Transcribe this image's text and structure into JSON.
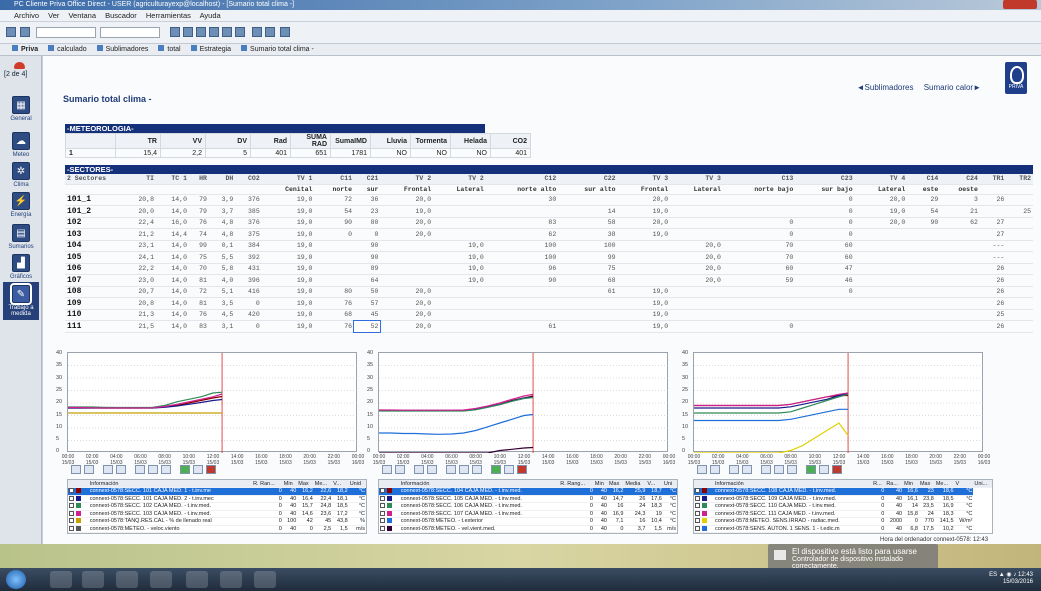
{
  "window": {
    "title": "PC Cliente Priva Office Direct - USER (agriculturayexp@localhost) - [Sumario total clima -]"
  },
  "menu": [
    "Archivo",
    "Ver",
    "Ventana",
    "Buscador",
    "Herramientas",
    "Ayuda"
  ],
  "tabs": [
    "Priva",
    "calculado",
    "Sublimadores",
    "total",
    "Estrategia",
    "Sumario total clima -"
  ],
  "sidebar": {
    "page_indicator": "[2 de 4]",
    "items": [
      {
        "label": "General",
        "icon": "general-icon"
      },
      {
        "label": "Meteo",
        "icon": "meteo-icon"
      },
      {
        "label": "Clima",
        "icon": "clima-icon"
      },
      {
        "label": "Energía",
        "icon": "energia-icon"
      },
      {
        "label": "Sumarios",
        "icon": "sumarios-icon"
      },
      {
        "label": "Gráficos",
        "icon": "graficos-icon"
      },
      {
        "label": "Trabajo a medida",
        "icon": "trabajo-icon"
      }
    ]
  },
  "page": {
    "title": "Sumario total clima -",
    "links": [
      "◄Sublimadores",
      "Sumario calor►"
    ],
    "logo": "PRIVA"
  },
  "meteo": {
    "heading": "-METEOROLOGIA-",
    "columns": [
      "TR",
      "VV",
      "DV",
      "Rad",
      "SUMA RAD",
      "SumaIMD",
      "Lluvia",
      "Tormenta",
      "Helada",
      "CO2"
    ],
    "row_label": "1",
    "values": [
      "15,4",
      "2,2",
      "5",
      "401",
      "651",
      "1781",
      "NO",
      "NO",
      "NO",
      "401"
    ]
  },
  "sectores": {
    "heading": "-SECTORES-",
    "columns": [
      "2 Sectores",
      "TI",
      "TC 1",
      "HR",
      "DH",
      "CO2",
      "TV 1",
      "C11",
      "C21",
      "TV 2",
      "TV 2",
      "C12",
      "C22",
      "TV 3",
      "TV 3",
      "C13",
      "C23",
      "TV 4",
      "C14",
      "C24",
      "TR1",
      "TR2"
    ],
    "subcolumns": [
      "",
      "",
      "",
      "",
      "",
      "",
      "Cenital",
      "norte",
      "sur",
      "Frontal",
      "Lateral",
      "norte alto",
      "sur alto",
      "Frontal",
      "Lateral",
      "norte bajo",
      "sur bajo",
      "Lateral",
      "este",
      "oeste",
      "",
      ""
    ],
    "rows": [
      [
        "101_1",
        "20,8",
        "14,0",
        "79",
        "3,9",
        "376",
        "19,0",
        "72",
        "36",
        "20,0",
        "",
        "30",
        "",
        "20,0",
        "",
        "",
        "0",
        "20,0",
        "29",
        "3",
        "26",
        ""
      ],
      [
        "101_2",
        "20,0",
        "14,0",
        "79",
        "3,7",
        "385",
        "19,0",
        "54",
        "23",
        "19,0",
        "",
        "",
        "14",
        "19,0",
        "",
        "",
        "0",
        "19,0",
        "54",
        "21",
        "",
        "25"
      ],
      [
        "102",
        "22,4",
        "16,0",
        "76",
        "4,8",
        "376",
        "19,0",
        "90",
        "80",
        "20,0",
        "",
        "83",
        "58",
        "20,0",
        "",
        "0",
        "0",
        "20,0",
        "90",
        "62",
        "27",
        ""
      ],
      [
        "103",
        "21,2",
        "14,4",
        "74",
        "4,8",
        "375",
        "19,0",
        "0",
        "0",
        "20,0",
        "",
        "62",
        "38",
        "19,0",
        "",
        "0",
        "0",
        "",
        "",
        "",
        "27",
        ""
      ],
      [
        "104",
        "23,1",
        "14,0",
        "99",
        "0,1",
        "384",
        "19,0",
        "",
        "90",
        "",
        "19,0",
        "100",
        "100",
        "",
        "20,0",
        "70",
        "60",
        "",
        "",
        "",
        "---",
        ""
      ],
      [
        "105",
        "24,1",
        "14,0",
        "75",
        "5,5",
        "392",
        "19,0",
        "",
        "90",
        "",
        "19,0",
        "100",
        "99",
        "",
        "20,0",
        "70",
        "60",
        "",
        "",
        "",
        "---",
        ""
      ],
      [
        "106",
        "22,2",
        "14,0",
        "70",
        "5,8",
        "431",
        "19,0",
        "",
        "89",
        "",
        "19,0",
        "96",
        "75",
        "",
        "20,0",
        "60",
        "47",
        "",
        "",
        "",
        "26",
        ""
      ],
      [
        "107",
        "23,0",
        "14,0",
        "81",
        "4,0",
        "396",
        "19,0",
        "",
        "64",
        "",
        "19,0",
        "90",
        "68",
        "",
        "20,0",
        "59",
        "46",
        "",
        "",
        "",
        "26",
        ""
      ],
      [
        "108",
        "20,7",
        "14,0",
        "72",
        "5,1",
        "416",
        "19,0",
        "80",
        "50",
        "20,0",
        "",
        "",
        "61",
        "19,0",
        "",
        "",
        "0",
        "",
        "",
        "",
        "26",
        ""
      ],
      [
        "109",
        "20,8",
        "14,0",
        "81",
        "3,5",
        "0",
        "19,0",
        "76",
        "57",
        "20,0",
        "",
        "",
        "",
        "19,0",
        "",
        "",
        "",
        "",
        "",
        "",
        "26",
        ""
      ],
      [
        "110",
        "21,3",
        "14,0",
        "76",
        "4,5",
        "420",
        "19,0",
        "68",
        "45",
        "20,0",
        "",
        "",
        "",
        "19,0",
        "",
        "",
        "",
        "",
        "",
        "",
        "25",
        ""
      ],
      [
        "111",
        "21,5",
        "14,0",
        "83",
        "3,1",
        "0",
        "19,0",
        "76",
        "52",
        "20,0",
        "",
        "61",
        "",
        "19,0",
        "",
        "0",
        "",
        "",
        "",
        "",
        "26",
        ""
      ]
    ]
  },
  "chart_common": {
    "y_ticks": [
      "40",
      "35",
      "30",
      "25",
      "20",
      "15",
      "10",
      "5",
      "0"
    ],
    "x_ticks": [
      "00:00 15/03",
      "02:00 15/03",
      "04:00 15/03",
      "06:00 15/03",
      "08:00 15/03",
      "10:00 15/03",
      "12:00 15/03",
      "14:00 15/03",
      "16:00 15/03",
      "18:00 15/03",
      "20:00 15/03",
      "22:00 15/03",
      "00:00 16/03"
    ]
  },
  "chart_data": [
    {
      "type": "line",
      "ylim": [
        0,
        40
      ],
      "x": [
        "00:00",
        "01:00",
        "02:00",
        "03:00",
        "04:00",
        "05:00",
        "06:00",
        "07:00",
        "08:00",
        "09:00",
        "10:00",
        "11:00",
        "12:00",
        "12:45"
      ],
      "series": [
        {
          "name": "connext-0578:SECC. 101 CAJA MED. 1 - t.inv.med.",
          "color": "#8b0000",
          "values": [
            18,
            18,
            18,
            18,
            18,
            18,
            18,
            18,
            18.5,
            19,
            20,
            21,
            22,
            22.6
          ]
        },
        {
          "name": "connext-0578:SECC. 101 CAJA MED. 2 - t.inv.med.",
          "color": "#1a1a8c",
          "values": [
            18,
            18,
            18,
            18,
            18,
            18,
            18,
            18,
            18.3,
            18.8,
            19.5,
            20.2,
            21,
            21.4
          ]
        },
        {
          "name": "connext-0578:SECC. 102 CAJA MED. - t.inv.med.",
          "color": "#2e8b57",
          "values": [
            18.4,
            18.4,
            18.4,
            18.3,
            18.2,
            18.2,
            18.2,
            18.3,
            19,
            20.5,
            21.5,
            22.5,
            24,
            24.3
          ]
        },
        {
          "name": "connext-0578:SECC. 103 CAJA MED. - t.inv.med.",
          "color": "#d02090",
          "values": [
            18.2,
            18.2,
            18.1,
            18,
            18,
            18,
            18,
            18.1,
            18.6,
            19.5,
            20.5,
            21.5,
            22.5,
            23.6
          ]
        },
        {
          "name": "connext-0578:TANQ.RES.CAL - % de llenado real",
          "color": "#c8a000",
          "values": [
            16,
            16,
            16,
            16,
            16,
            16,
            16,
            16,
            16,
            16,
            16,
            16,
            16,
            16
          ]
        },
        {
          "name": "connext-0578:METEO. - veloc.viento",
          "color": "#555555",
          "values": [
            null,
            null,
            null,
            null,
            null,
            null,
            null,
            null,
            null,
            null,
            null,
            null,
            null,
            null
          ]
        }
      ]
    },
    {
      "type": "line",
      "ylim": [
        0,
        40
      ],
      "x": [
        "00:00",
        "01:00",
        "02:00",
        "03:00",
        "04:00",
        "05:00",
        "06:00",
        "07:00",
        "08:00",
        "09:00",
        "10:00",
        "11:00",
        "12:00",
        "12:45"
      ],
      "series": [
        {
          "name": "connext-0578:SECC. 104 CAJA MED. - t.inv.med.",
          "color": "#8b0000",
          "values": [
            17,
            17,
            17,
            17,
            17,
            17,
            17,
            17,
            17.5,
            18.5,
            19.5,
            21,
            22,
            22.8
          ]
        },
        {
          "name": "connext-0578:SECC. 105 CAJA MED. - t.inv.med.",
          "color": "#1a1a8c",
          "values": [
            17,
            17,
            17,
            17,
            17,
            17,
            17,
            17,
            17.4,
            18.4,
            19.4,
            20.8,
            22,
            22.4
          ]
        },
        {
          "name": "connext-0578:SECC. 106 CAJA MED. - t.inv.med.",
          "color": "#2e8b57",
          "values": [
            16.8,
            16.8,
            16.8,
            16.8,
            16.8,
            16.8,
            16.8,
            16.8,
            17.3,
            18.3,
            19.3,
            20.7,
            21.8,
            22.2
          ]
        },
        {
          "name": "connext-0578:SECC. 107 CAJA MED. - t.inv.med.",
          "color": "#d02090",
          "values": [
            17.2,
            17.2,
            17.1,
            17.1,
            17.1,
            17.1,
            17.1,
            17.2,
            17.8,
            18.8,
            20,
            21.5,
            22.8,
            23.5
          ]
        },
        {
          "name": "connext-0578:METEO. - t.exterior",
          "color": "#1e6fd9",
          "values": [
            8,
            8,
            7.8,
            7.8,
            7.6,
            7.5,
            7.6,
            8,
            9,
            10.5,
            12,
            13.5,
            15,
            15.4
          ]
        },
        {
          "name": "connext-0578:METEO. - vel.vient.med.",
          "color": "#330033",
          "values": [
            0,
            0,
            0,
            0,
            0,
            0,
            0,
            0,
            0,
            0,
            1,
            1.5,
            2,
            2.2
          ]
        }
      ]
    },
    {
      "type": "line",
      "ylim": [
        0,
        40
      ],
      "x": [
        "00:00",
        "01:00",
        "02:00",
        "03:00",
        "04:00",
        "05:00",
        "06:00",
        "07:00",
        "08:00",
        "09:00",
        "10:00",
        "11:00",
        "12:00",
        "12:45"
      ],
      "series": [
        {
          "name": "connext-0578:SECC. 108 CAJA MED. - t.inv.med.",
          "color": "#8b0000",
          "values": [
            19,
            19,
            19,
            19,
            19,
            19,
            19,
            19,
            19.5,
            20.5,
            21.5,
            22.5,
            23,
            23
          ]
        },
        {
          "name": "connext-0578:SECC. 109 CAJA MED. - t.inv.med.",
          "color": "#1a1a8c",
          "values": [
            18,
            18,
            18,
            18,
            18,
            18,
            18,
            18,
            18.5,
            19.5,
            20.5,
            21.5,
            23,
            23.8
          ]
        },
        {
          "name": "connext-0578:SECC. 110 CAJA MED. - t.inv.med.",
          "color": "#2e8b57",
          "values": [
            16,
            16,
            16,
            16,
            16,
            16,
            16,
            16,
            16.5,
            18,
            19.5,
            21,
            22.5,
            23.5
          ]
        },
        {
          "name": "connext-0578:SECC. 111 CAJA MED. - t.inv.med.",
          "color": "#d02090",
          "values": [
            19,
            19,
            19,
            19,
            19,
            19,
            19,
            19,
            19.5,
            20.5,
            21.5,
            22.5,
            23.5,
            24
          ]
        },
        {
          "name": "connext-0578:METEO. SENS.IRRAD - radiac.med.",
          "color": "#e0d000",
          "values": [
            0,
            0,
            0,
            0,
            0,
            0,
            0,
            0,
            1,
            3,
            6,
            9,
            12,
            7
          ]
        },
        {
          "name": "connext-0578:SENS. AUTON. 1 SENS. 1 - t.edic.m",
          "color": "#1e6fd9",
          "values": [
            13,
            13,
            13,
            13,
            13,
            13,
            13,
            13,
            13.5,
            14.5,
            15.5,
            16.5,
            17.5,
            17.5
          ]
        }
      ]
    }
  ],
  "legends": [
    {
      "headers": [
        "Información",
        "R. Ran...",
        "Min",
        "Max",
        "Me...",
        "V...",
        "Unid"
      ],
      "rows": [
        [
          "connext-0578:SECC. 101 CAJA MED. 1 - t.inv.me",
          "0",
          "40",
          "16,2",
          "22,6",
          "18,2",
          "°C"
        ],
        [
          "connext-0578:SECC. 101 CAJA MED. 2 - t.inv.mec",
          "0",
          "40",
          "16,4",
          "22,4",
          "18,1",
          "°C"
        ],
        [
          "connext-0578:SECC. 102 CAJA MED. - t.inv.med.",
          "0",
          "40",
          "15,7",
          "24,8",
          "18,5",
          "°C"
        ],
        [
          "connext-0578:SECC. 103 CAJA MED. - t.inv.med.",
          "0",
          "40",
          "14,6",
          "23,6",
          "17,2",
          "°C"
        ],
        [
          "connext-0578:TANQ.RES.CAL - % de llenado real",
          "0",
          "100",
          "42",
          "45",
          "43,8",
          "%"
        ],
        [
          "connext-0578:METEO. - veloc.viento",
          "0",
          "40",
          "0",
          "2,5",
          "1,5",
          "m/s"
        ]
      ]
    },
    {
      "headers": [
        "Información",
        "R. Rang...",
        "Min",
        "Max",
        "Media",
        "V...",
        "Uni"
      ],
      "rows": [
        [
          "connext-0578:SECC. 104 CAJA MED. - t.inv.med.",
          "0",
          "40",
          "16,2",
          "25,9",
          "18,7",
          "°C"
        ],
        [
          "connext-0578:SECC. 105 CAJA MED. - t.inv.med.",
          "0",
          "40",
          "14,7",
          "26",
          "17,6",
          "°C"
        ],
        [
          "connext-0578:SECC. 106 CAJA MED. - t.inv.med.",
          "0",
          "40",
          "16",
          "24",
          "18,3",
          "°C"
        ],
        [
          "connext-0578:SECC. 107 CAJA MED. - t.inv.med.",
          "0",
          "40",
          "16,9",
          "24,3",
          "19",
          "°C"
        ],
        [
          "connext-0578:METEO. - t.exterior",
          "0",
          "40",
          "7,1",
          "16",
          "10,4",
          "°C"
        ],
        [
          "connext-0578:METEO. - vel.vient.med.",
          "0",
          "40",
          "0",
          "3,7",
          "1,5",
          "m/s"
        ]
      ]
    },
    {
      "headers": [
        "Información",
        "R...",
        "Ra...",
        "Min",
        "Max",
        "Me...",
        "V",
        "Uni..."
      ],
      "rows": [
        [
          "connext-0578:SECC. 108 CAJA MED. - t.inv.med.",
          "0",
          "40",
          "16,6",
          "23",
          "18,6",
          "°C"
        ],
        [
          "connext-0578:SECC. 109 CAJA MED. - t.inv.med.",
          "0",
          "40",
          "16,1",
          "23,8",
          "18,5",
          "°C"
        ],
        [
          "connext-0578:SECC. 110 CAJA MED. - t.inv.med.",
          "0",
          "40",
          "14",
          "23,5",
          "16,9",
          "°C"
        ],
        [
          "connext-0578:SECC. 111 CAJA MED. - t.inv.med.",
          "0",
          "40",
          "15,8",
          "24",
          "18,3",
          "°C"
        ],
        [
          "connext-0578:METEO. SENS.IRRAD - radiac.med.",
          "0",
          "2000",
          "0",
          "770",
          "141,5",
          "W/m²"
        ],
        [
          "connext-0578:SENS. AUTON. 1 SENS. 1 - t.edic.m",
          "0",
          "40",
          "6,8",
          "17,5",
          "10,2",
          "°C"
        ]
      ]
    }
  ],
  "notification": {
    "title": "El dispositivo está listo para usarse",
    "body": "Controlador de dispositivo instalado correctamente."
  },
  "status_right": "Hora del ordenador connext-0578: 12:43",
  "tray": {
    "lang": "ES",
    "time": "12:43",
    "date": "15/03/2016"
  }
}
